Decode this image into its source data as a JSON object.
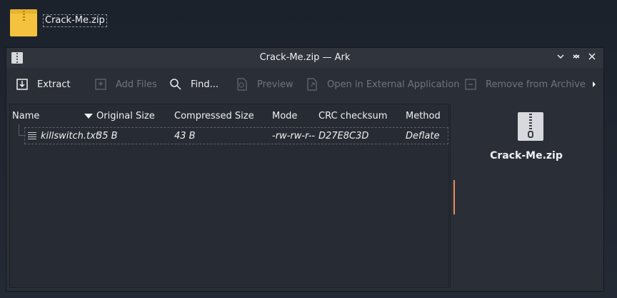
{
  "desktop": {
    "icon_label": "Crack-Me.zip"
  },
  "window": {
    "title": "Crack-Me.zip — Ark",
    "buttons": {
      "menu": "⌄",
      "minimize": "⌄",
      "maximize": "⌃",
      "close": "✕"
    }
  },
  "toolbar": {
    "items": [
      {
        "label": "Extract",
        "icon": "extract-icon",
        "enabled": true
      },
      {
        "label": "Add Files",
        "icon": "add-files-icon",
        "enabled": false
      },
      {
        "label": "Find...",
        "icon": "search-icon",
        "enabled": true
      },
      {
        "label": "Preview",
        "icon": "preview-icon",
        "enabled": false
      },
      {
        "label": "Open in External Application",
        "icon": "open-external-icon",
        "enabled": false
      },
      {
        "label": "Remove from Archive",
        "icon": "remove-icon",
        "enabled": false
      }
    ],
    "more_icon": "chevron-right-icon"
  },
  "table": {
    "columns": [
      "Name",
      "Original Size",
      "Compressed Size",
      "Mode",
      "CRC checksum",
      "Method"
    ],
    "sort_column": "Original Size",
    "rows": [
      {
        "name": "killswitch.txt",
        "original_size": "35 B",
        "compressed_size": "43 B",
        "mode": "-rw-rw-r--",
        "crc": "D27E8C3D",
        "method": "Deflate"
      }
    ]
  },
  "info_panel": {
    "name": "Crack-Me.zip",
    "accent_color": "#e98a5a"
  }
}
